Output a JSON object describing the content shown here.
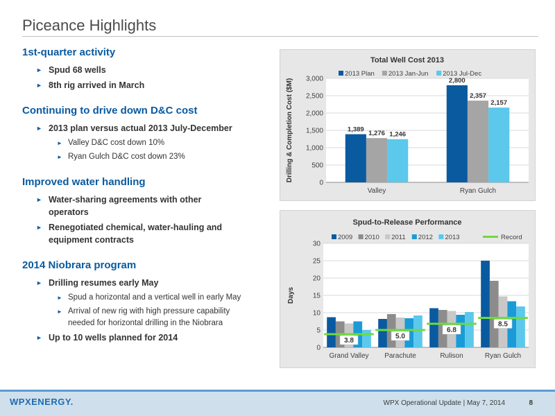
{
  "page": {
    "title": "Piceance Highlights"
  },
  "sections": [
    {
      "heading": "1st-quarter activity",
      "bullets": [
        {
          "text": "Spud 68 wells",
          "sub": []
        },
        {
          "text": "8th rig arrived in March",
          "sub": []
        }
      ]
    },
    {
      "heading": "Continuing to drive down D&C cost",
      "bullets": [
        {
          "text": "2013 plan versus actual 2013 July-December",
          "sub": [
            "Valley D&C cost down 10%",
            "Ryan Gulch D&C cost down 23%"
          ]
        }
      ]
    },
    {
      "heading": "Improved water handling",
      "bullets": [
        {
          "text": "Water-sharing agreements with other operators",
          "sub": []
        },
        {
          "text": "Renegotiated chemical, water-hauling and equipment contracts",
          "sub": []
        }
      ]
    },
    {
      "heading": "2014 Niobrara program",
      "bullets": [
        {
          "text": "Drilling resumes early May",
          "sub": [
            "Spud a horizontal and a vertical well in early May",
            "Arrival of new rig with high pressure capability needed for horizontal drilling in the Niobrara"
          ]
        },
        {
          "text": "Up to 10 wells planned for 2014",
          "sub": []
        }
      ]
    }
  ],
  "footer": {
    "logo": "WPXENERGY.",
    "text": "WPX Operational Update  |  May 7, 2014",
    "page_number": "8"
  },
  "chart_data": [
    {
      "type": "bar",
      "title": "Total Well Cost 2013",
      "xlabel": "",
      "ylabel": "Drilling & Completion Cost ($M)",
      "ylim": [
        0,
        3000
      ],
      "yticks": [
        0,
        500,
        1000,
        1500,
        2000,
        2500,
        3000
      ],
      "ytick_labels": [
        "0",
        "500",
        "1,000",
        "1,500",
        "2,000",
        "2,500",
        "3,000"
      ],
      "grid": true,
      "legend": "top",
      "categories": [
        "Valley",
        "Ryan Gulch"
      ],
      "series": [
        {
          "name": "2013 Plan",
          "color": "#0a5aa0",
          "values": [
            1389,
            2800
          ],
          "labels": [
            "1,389",
            "2,800"
          ]
        },
        {
          "name": "2013 Jan-Jun",
          "color": "#a5a5a5",
          "values": [
            1276,
            2357
          ],
          "labels": [
            "1,276",
            "2,357"
          ]
        },
        {
          "name": "2013 Jul-Dec",
          "color": "#5bc8ec",
          "values": [
            1246,
            2157
          ],
          "labels": [
            "1,246",
            "2,157"
          ]
        }
      ]
    },
    {
      "type": "bar",
      "title": "Spud-to-Release Performance",
      "xlabel": "",
      "ylabel": "Days",
      "ylim": [
        0,
        30
      ],
      "yticks": [
        0,
        5,
        10,
        15,
        20,
        25,
        30
      ],
      "ytick_labels": [
        "0",
        "5",
        "10",
        "15",
        "20",
        "25",
        "30"
      ],
      "grid": true,
      "legend": "top",
      "categories": [
        "Grand Valley",
        "Parachute",
        "Rulison",
        "Ryan Gulch"
      ],
      "series": [
        {
          "name": "2009",
          "color": "#0a5aa0",
          "values": [
            8.7,
            8.2,
            11.3,
            25.0
          ]
        },
        {
          "name": "2010",
          "color": "#8c8c8c",
          "values": [
            7.5,
            9.6,
            10.8,
            19.2
          ]
        },
        {
          "name": "2011",
          "color": "#c8c8c8",
          "values": [
            6.9,
            8.6,
            10.5,
            14.7
          ]
        },
        {
          "name": "2012",
          "color": "#1a9bd7",
          "values": [
            7.5,
            8.4,
            9.4,
            13.3
          ]
        },
        {
          "name": "2013",
          "color": "#5bc8ec",
          "values": [
            5.0,
            9.2,
            10.2,
            11.8
          ]
        }
      ],
      "record": {
        "name": "Record",
        "color": "#6edb3a",
        "values": [
          3.8,
          5.0,
          6.8,
          8.5
        ],
        "labels": [
          "3.8",
          "5.0",
          "6.8",
          "8.5"
        ]
      }
    }
  ]
}
